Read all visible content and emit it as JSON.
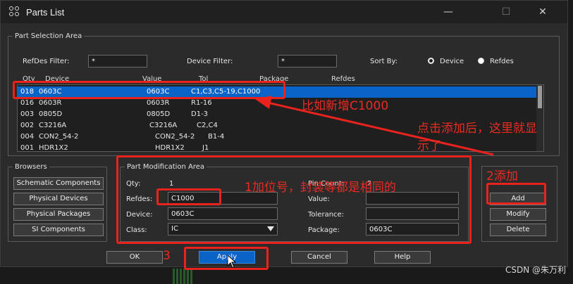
{
  "window": {
    "title": "Parts List",
    "minimize": "—",
    "maximize": "☐",
    "close": "✕"
  },
  "part_selection": {
    "legend": "Part Selection Area",
    "refdes_filter_label": "RefDes Filter:",
    "refdes_filter_value": "*",
    "device_filter_label": "Device Filter:",
    "device_filter_value": "*",
    "sort_by_label": "Sort By:",
    "sort_device_label": "Device",
    "sort_refdes_label": "Refdes",
    "sort_selected": "Device",
    "columns": {
      "qty": "Qty",
      "device": "Device",
      "value": "Value",
      "tol": "Tol",
      "package": "Package",
      "refdes": "Refdes"
    },
    "rows": [
      {
        "qty": "018",
        "device": "0603C",
        "value": "0603C",
        "refdes": "C1,C3,C5-19,C1000",
        "selected": true
      },
      {
        "qty": "016",
        "device": "0603R",
        "value": "0603R",
        "refdes": "R1-16"
      },
      {
        "qty": "003",
        "device": "0805D",
        "value": "0805D",
        "refdes": "D1-3"
      },
      {
        "qty": "002",
        "device": "C3216A",
        "value": "C3216A",
        "refdes": "C2,C4"
      },
      {
        "qty": "004",
        "device": "CON2_54-2",
        "value": "CON2_54-2",
        "refdes": "B1-4"
      },
      {
        "qty": "001",
        "device": "HDR1X2",
        "value": "HDR1X2",
        "refdes": "J1"
      }
    ]
  },
  "browsers": {
    "legend": "Browsers",
    "buttons": [
      "Schematic Components",
      "Physical Devices",
      "Physical Packages",
      "SI Components"
    ]
  },
  "part_mod": {
    "legend": "Part Modification Area",
    "qty_label": "Qty:",
    "qty_value": "1",
    "pin_count_label": "Pin Count:",
    "pin_count_value": "2",
    "refdes_label": "Refdes:",
    "refdes_value": "C1000",
    "value_label": "Value:",
    "value_value": "",
    "device_label": "Device:",
    "device_value": "0603C",
    "tolerance_label": "Tolerance:",
    "tolerance_value": "",
    "class_label": "Class:",
    "class_value": "IC",
    "package_label": "Package:",
    "package_value": "0603C"
  },
  "side_buttons": {
    "add": "Add",
    "modify": "Modify",
    "delete": "Delete"
  },
  "bottom_buttons": {
    "ok": "OK",
    "apply": "Apply",
    "cancel": "Cancel",
    "help": "Help"
  },
  "annotations": {
    "new_c1000": "比如新增C1000",
    "click_add_note_line1": "点击添加后，这里就显",
    "click_add_note_line2": "示了",
    "step1": "1加位号，封装等都是相同的",
    "step2": "2添加",
    "step3": "3"
  },
  "watermark": "CSDN @朱万利",
  "colors": {
    "annotation_red": "#e8231d",
    "selection_blue": "#0a64c8",
    "dialog_bg": "#2b2b2b"
  },
  "icons": [
    "parts-list-app-icon",
    "minimize-icon",
    "maximize-icon",
    "close-icon",
    "dropdown-arrow-icon",
    "mouse-cursor-icon"
  ]
}
